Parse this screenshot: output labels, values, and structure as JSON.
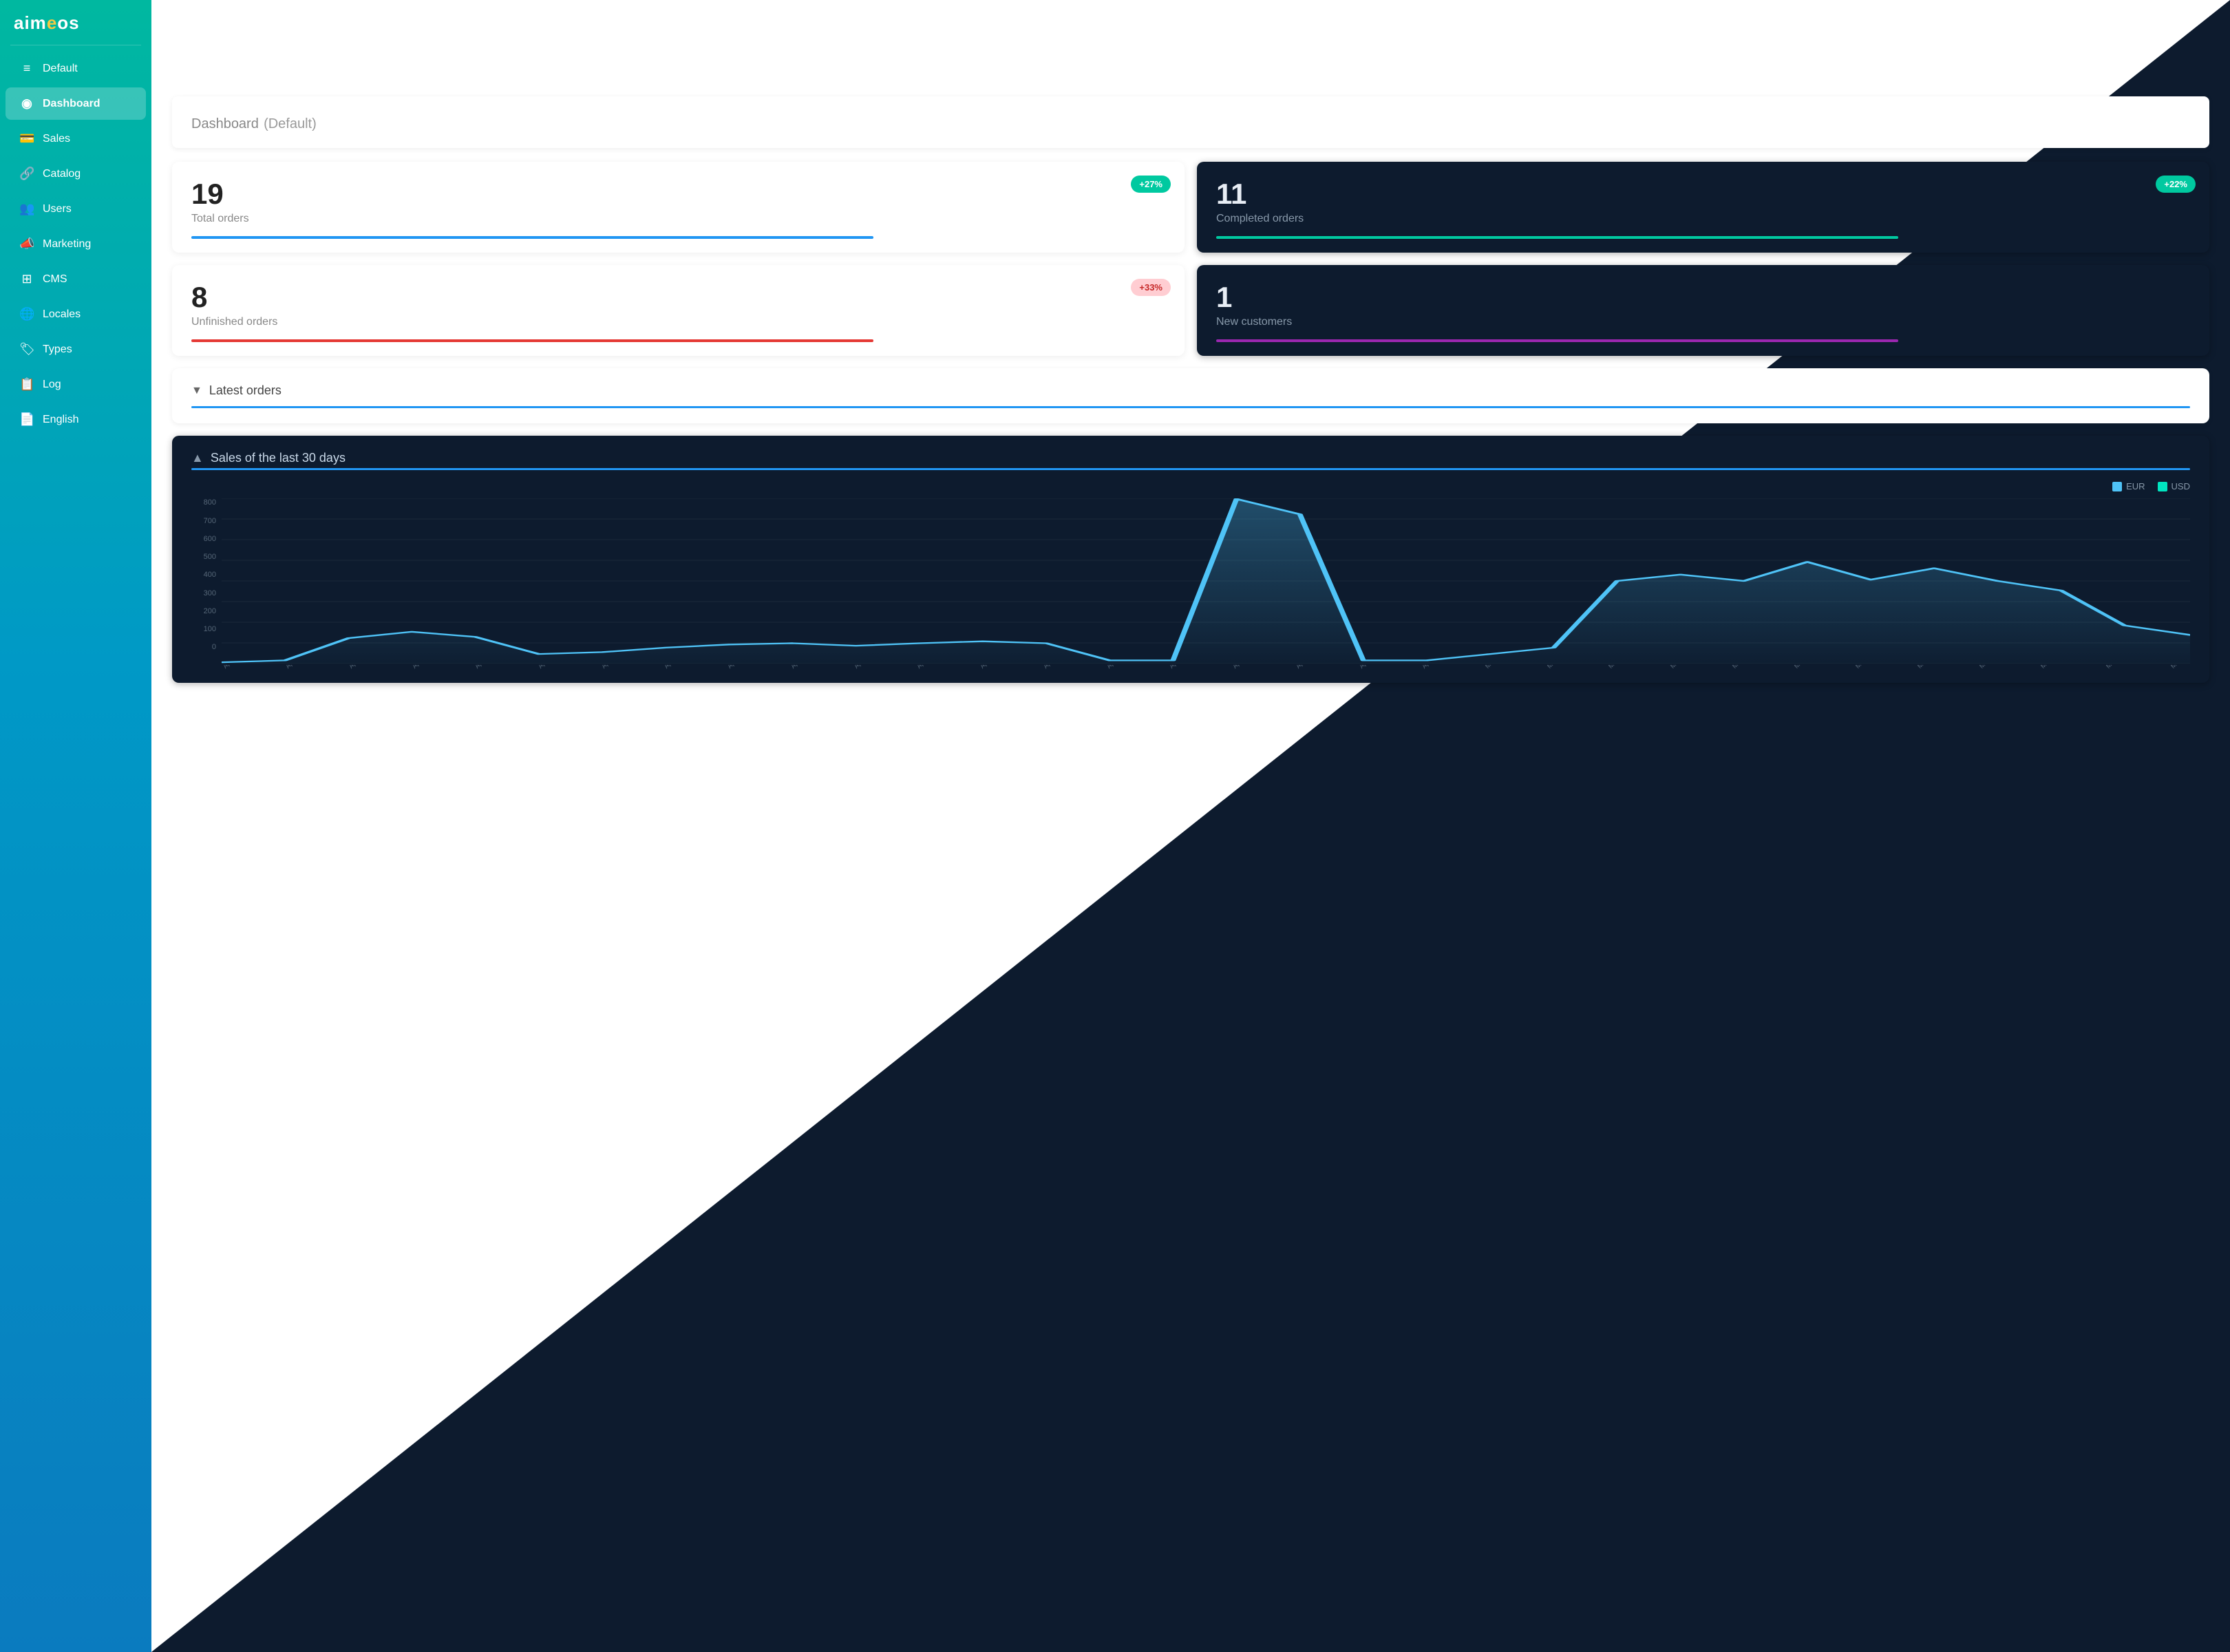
{
  "app": {
    "logo_text": "aim",
    "logo_accent": "e",
    "logo_suffix": "os"
  },
  "sidebar": {
    "items": [
      {
        "id": "default",
        "icon": "≡",
        "label": "Default",
        "active": false
      },
      {
        "id": "dashboard",
        "icon": "◉",
        "label": "Dashboard",
        "active": true
      },
      {
        "id": "sales",
        "icon": "💳",
        "label": "Sales",
        "active": false
      },
      {
        "id": "catalog",
        "icon": "🔗",
        "label": "Catalog",
        "active": false
      },
      {
        "id": "users",
        "icon": "👥",
        "label": "Users",
        "active": false
      },
      {
        "id": "marketing",
        "icon": "📣",
        "label": "Marketing",
        "active": false
      },
      {
        "id": "cms",
        "icon": "⊞",
        "label": "CMS",
        "active": false
      },
      {
        "id": "locales",
        "icon": "🌐",
        "label": "Locales",
        "active": false
      },
      {
        "id": "types",
        "icon": "🏷",
        "label": "Types",
        "active": false
      },
      {
        "id": "log",
        "icon": "📋",
        "label": "Log",
        "active": false
      },
      {
        "id": "english",
        "icon": "📄",
        "label": "English",
        "active": false
      }
    ]
  },
  "header": {
    "title": "Dashboard",
    "subtitle": "(Default)"
  },
  "stats": [
    {
      "id": "total-orders",
      "number": "19",
      "label": "Total orders",
      "badge": "+27%",
      "badge_type": "positive",
      "bar_color": "blue",
      "dark": false
    },
    {
      "id": "completed-orders",
      "number": "11",
      "label": "Completed orders",
      "badge": "+22%",
      "badge_type": "positive",
      "bar_color": "green",
      "dark": true
    },
    {
      "id": "unfinished-orders",
      "number": "8",
      "label": "Unfinished orders",
      "badge": "+33%",
      "badge_type": "warning",
      "bar_color": "red",
      "dark": false
    },
    {
      "id": "new-customers",
      "number": "1",
      "label": "New customers",
      "badge": null,
      "bar_color": "purple",
      "dark": true
    }
  ],
  "latest_orders": {
    "label": "Latest orders"
  },
  "sales_chart": {
    "label": "Sales of the last 30 days",
    "legend": {
      "eur": "EUR",
      "usd": "USD"
    },
    "y_labels": [
      "0",
      "100",
      "200",
      "300",
      "400",
      "500",
      "600",
      "700",
      "800"
    ],
    "x_labels": [
      "Apr 11",
      "Apr 12",
      "Apr 13",
      "Apr 14",
      "Apr 15",
      "Apr 16",
      "Apr 17",
      "Apr 18",
      "Apr 19",
      "Apr 20",
      "Apr 21",
      "Apr 22",
      "Apr 23",
      "Apr 24",
      "Apr 25",
      "Apr 26",
      "Apr 27",
      "Apr 28",
      "Apr 29",
      "Apr 30",
      "May 1",
      "May 2",
      "May 3",
      "May 4",
      "May 5",
      "May 6",
      "May 7",
      "May 8",
      "May 9",
      "May 10",
      "May 11",
      "May 12"
    ]
  },
  "icons": {
    "moon": "☾",
    "logout": "⎋",
    "chevron_down": "▼",
    "chevron_up": "▲"
  }
}
